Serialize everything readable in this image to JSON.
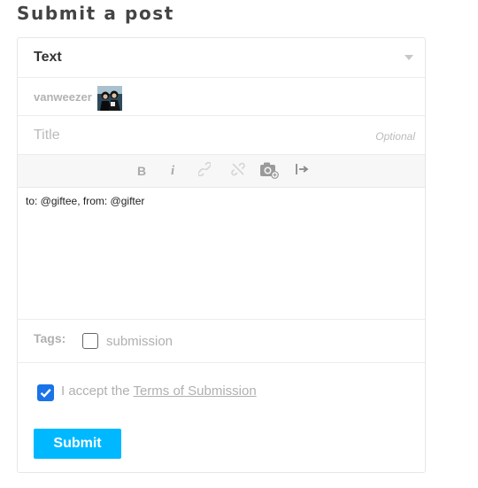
{
  "page": {
    "title": "Submit a post"
  },
  "form": {
    "post_type": {
      "selected": "Text"
    },
    "blog": {
      "name": "vanweezer"
    },
    "title_field": {
      "placeholder": "Title",
      "hint": "Optional"
    },
    "toolbar": {
      "bold_label": "B",
      "italic_label": "i",
      "icons": [
        "link-icon",
        "unlink-icon",
        "camera-icon",
        "read-more-icon"
      ]
    },
    "body": {
      "value": "to: @giftee, from: @gifter"
    },
    "tags": {
      "label": "Tags:",
      "option": "submission",
      "checked": false
    },
    "accept": {
      "prefix": "I accept the",
      "link_text": "Terms of Submission",
      "checked": true
    },
    "submit_label": "Submit",
    "colors": {
      "accent": "#00b8ff",
      "checkbox_checked": "#1a73e8",
      "muted_text": "#b0b0b0"
    }
  }
}
